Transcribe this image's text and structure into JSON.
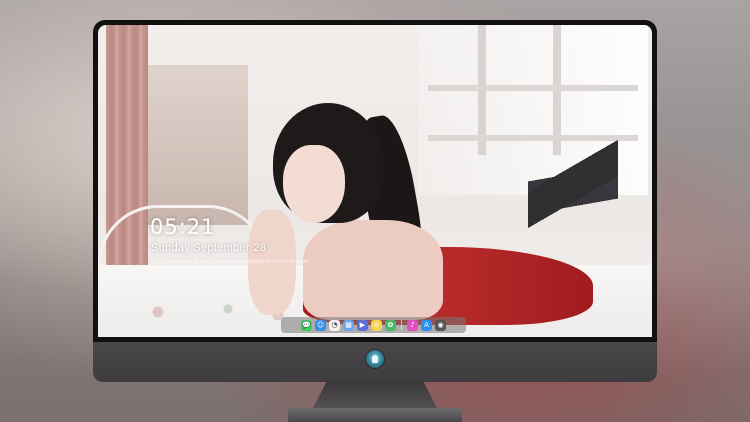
{
  "lock_screen": {
    "time": "05:21",
    "date": "Sunday September 28",
    "subtitle": "Lorem ipsum dolor sit amet, consectetur adipiscing elit sed do eiusmod"
  },
  "dock": {
    "apps": [
      {
        "name": "messages-icon",
        "glyph": "💬",
        "color": "#3ecf5a"
      },
      {
        "name": "finder-icon",
        "glyph": "☺",
        "color": "#3b8ee8"
      },
      {
        "name": "clock-icon",
        "glyph": "◔",
        "color": "#f2f2f2"
      },
      {
        "name": "preview-icon",
        "glyph": "▦",
        "color": "#6aa6e8"
      },
      {
        "name": "movie-icon",
        "glyph": "▶",
        "color": "#5b6fd8"
      },
      {
        "name": "notes-icon",
        "glyph": "≡",
        "color": "#f5d34c"
      },
      {
        "name": "photos-icon",
        "glyph": "✿",
        "color": "#4cb86a"
      },
      {
        "name": "itunes-icon",
        "glyph": "♪",
        "color": "#e04fc2"
      },
      {
        "name": "app-store-icon",
        "glyph": "A",
        "color": "#2f8ff0"
      },
      {
        "name": "camera-icon",
        "glyph": "◉",
        "color": "#555555"
      }
    ]
  },
  "colors": {
    "bezel": "#111111",
    "chin": "#4a474b",
    "dock_bg": "#787878"
  }
}
